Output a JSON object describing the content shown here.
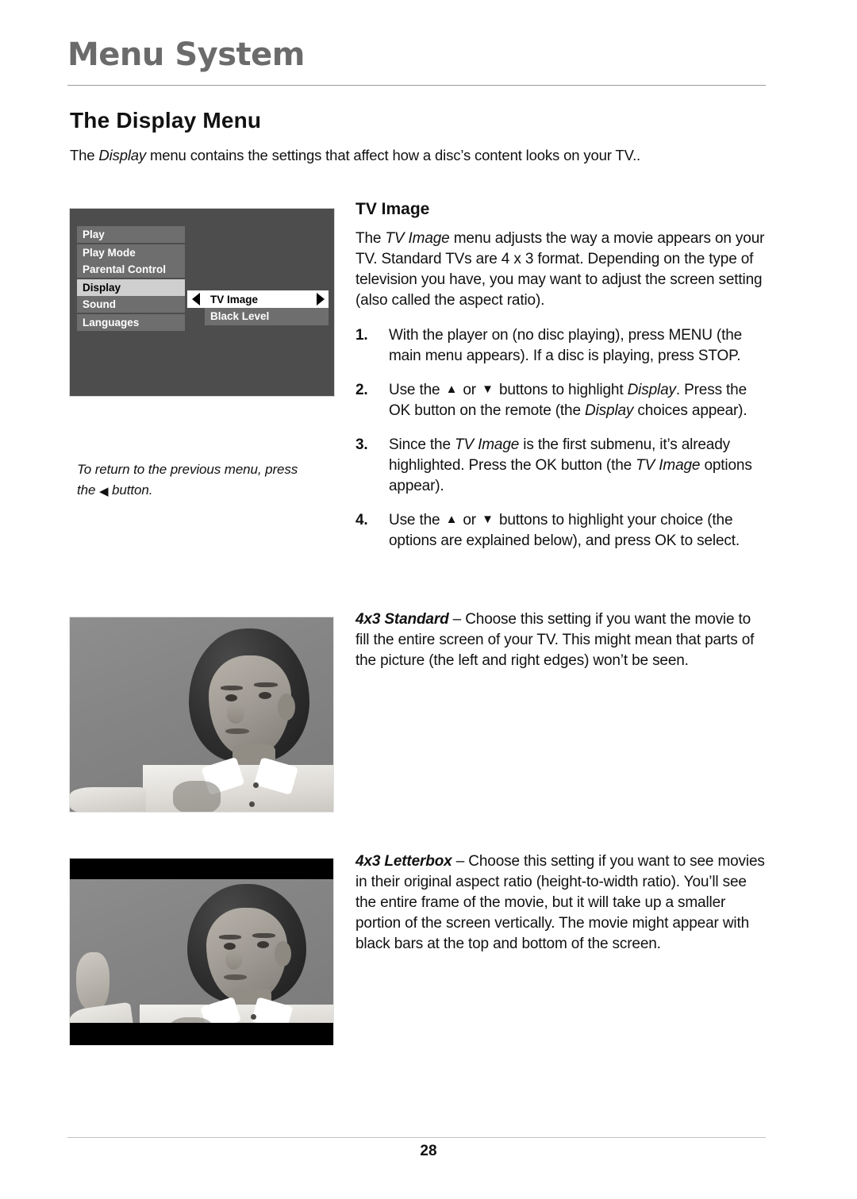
{
  "header": {
    "title": "Menu System"
  },
  "section": {
    "title": "The Display Menu",
    "intro_prefix": "The ",
    "intro_italic": "Display",
    "intro_rest": " menu contains the settings that affect how a disc’s content looks on your TV.."
  },
  "menu_screen": {
    "main_items": [
      {
        "label": "Play",
        "selected": false
      },
      {
        "label": "Play Mode",
        "selected": false
      },
      {
        "label": "Parental Control",
        "selected": false
      },
      {
        "label": "Display",
        "selected": true
      },
      {
        "label": "Sound",
        "selected": false
      },
      {
        "label": "Languages",
        "selected": false
      }
    ],
    "submenu_items": [
      {
        "label": "TV Image",
        "selected": true
      },
      {
        "label": "Black Level",
        "selected": false
      }
    ],
    "left_arrow_icon": "triangle-left-icon",
    "right_arrow_icon": "triangle-right-icon"
  },
  "side_note": {
    "part1": "To return to the previous menu, press the ",
    "glyph": "◀",
    "part2": " button."
  },
  "tv_image": {
    "heading": "TV Image",
    "intro": {
      "p1": "The ",
      "italic": "TV Image",
      "p2": " menu adjusts the way a movie appears on your TV. Standard TVs are 4 x 3 format. Depending on the type of television you have, you may want to adjust the screen setting (also called the aspect ratio)."
    },
    "steps": [
      {
        "number": "1.",
        "segments": [
          {
            "text": "With the player on (no disc playing), press MENU (the main menu appears). If a disc is playing, press STOP.",
            "style": "normal"
          }
        ]
      },
      {
        "number": "2.",
        "segments": [
          {
            "text": "Use the ",
            "style": "normal"
          },
          {
            "text": "▲",
            "style": "glyph-up"
          },
          {
            "text": " or ",
            "style": "normal"
          },
          {
            "text": "▼",
            "style": "glyph-down"
          },
          {
            "text": " buttons to highlight ",
            "style": "normal"
          },
          {
            "text": "Display",
            "style": "italic"
          },
          {
            "text": ". Press the OK button on the remote (the ",
            "style": "normal"
          },
          {
            "text": "Display",
            "style": "italic"
          },
          {
            "text": " choices appear).",
            "style": "normal"
          }
        ]
      },
      {
        "number": "3.",
        "segments": [
          {
            "text": "Since the ",
            "style": "normal"
          },
          {
            "text": "TV Image",
            "style": "italic"
          },
          {
            "text": " is the first submenu, it’s already highlighted. Press the OK button (the ",
            "style": "normal"
          },
          {
            "text": "TV Image",
            "style": "italic"
          },
          {
            "text": " options appear).",
            "style": "normal"
          }
        ]
      },
      {
        "number": "4.",
        "segments": [
          {
            "text": "Use the ",
            "style": "normal"
          },
          {
            "text": "▲",
            "style": "glyph-up"
          },
          {
            "text": " or ",
            "style": "normal"
          },
          {
            "text": "▼",
            "style": "glyph-down"
          },
          {
            "text": " buttons to highlight your choice (the options are explained below), and press OK to select.",
            "style": "normal"
          }
        ]
      }
    ]
  },
  "options": [
    {
      "name": "4x3 Standard",
      "dash": " – ",
      "description": "Choose this setting if you want the movie to fill the entire screen of your TV. This might mean that parts of the picture (the left and right edges) won’t be seen."
    },
    {
      "name": "4x3 Letterbox",
      "dash": " – ",
      "description": "Choose this setting if you want to see movies in their original aspect ratio (height-to-width ratio). You’ll see the entire frame of the movie, but it will take up a smaller portion of the screen vertically. The movie might appear with black bars at the top and bottom of the screen."
    }
  ],
  "photos": {
    "standard_caption": "4x3 Standard example photo of a boy",
    "letterbox_caption": "4x3 Letterbox example photo of a boy with black bars"
  },
  "footer": {
    "page_number": "28"
  },
  "colors": {
    "header_gray": "#6b6b6b",
    "menu_background": "#4d4d4d",
    "menu_row": "#6e6e6e",
    "menu_selected": "#cfcfcf",
    "rule": "#9a9a9a"
  }
}
